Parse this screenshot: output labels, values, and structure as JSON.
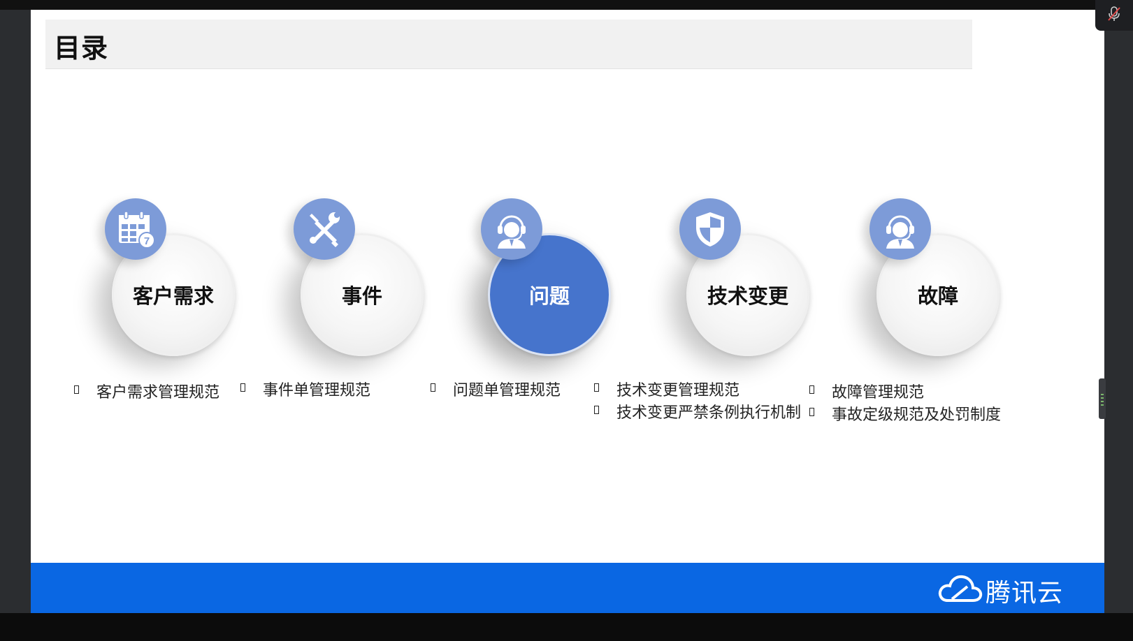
{
  "slide": {
    "title": "目录",
    "items": [
      {
        "label": "客户需求",
        "icon": "calendar-icon",
        "active": false,
        "bullets": [
          "客户需求管理规范"
        ]
      },
      {
        "label": "事件",
        "icon": "tools-icon",
        "active": false,
        "bullets": [
          "事件单管理规范"
        ]
      },
      {
        "label": "问题",
        "icon": "headset-agent-icon",
        "active": true,
        "bullets": [
          "问题单管理规范"
        ]
      },
      {
        "label": "技术变更",
        "icon": "shield-icon",
        "active": false,
        "bullets": [
          "技术变更管理规范",
          "技术变更严禁条例执行机制"
        ]
      },
      {
        "label": "故障",
        "icon": "headset-agent-icon",
        "active": false,
        "bullets": [
          "故障管理规范",
          "事故定级规范及处罚制度"
        ]
      }
    ]
  },
  "footer": {
    "brand_name": "腾讯云",
    "brand_icon": "tencent-cloud-logo"
  },
  "colors": {
    "accent": "#4674cc",
    "icon_badge": "#7d9bd8",
    "footer": "#0a67e3"
  }
}
